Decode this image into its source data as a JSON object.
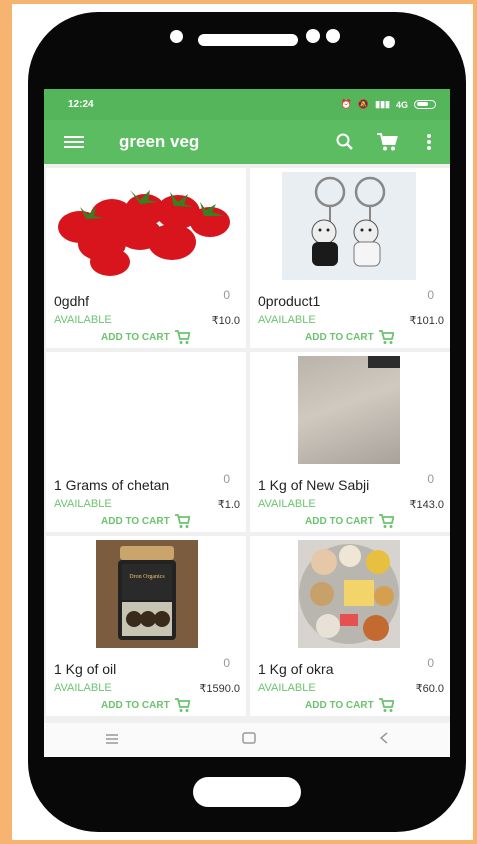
{
  "status": {
    "time": "12:24",
    "network": "4G"
  },
  "toolbar": {
    "title": "green veg",
    "icons": [
      "menu-icon",
      "search-icon",
      "cart-icon",
      "overflow-icon"
    ]
  },
  "products": [
    {
      "name": "0gdhf",
      "qty": "0",
      "availability": "AVAILABLE",
      "price": "₹10.0",
      "cart_label": "ADD TO CART",
      "image": "strawberries"
    },
    {
      "name": "0product1",
      "qty": "0",
      "availability": "AVAILABLE",
      "price": "₹101.0",
      "cart_label": "ADD TO CART",
      "image": "keychains"
    },
    {
      "name": "1 Grams of chetan",
      "qty": "0",
      "availability": "AVAILABLE",
      "price": "₹1.0",
      "cart_label": "ADD TO CART",
      "image": ""
    },
    {
      "name": "1 Kg of New Sabji",
      "qty": "0",
      "availability": "AVAILABLE",
      "price": "₹143.0",
      "cart_label": "ADD TO CART",
      "image": "photo"
    },
    {
      "name": "1 Kg of oil",
      "qty": "0",
      "availability": "AVAILABLE",
      "price": "₹1590.0",
      "cart_label": "ADD TO CART",
      "image": "jar"
    },
    {
      "name": "1 Kg of okra",
      "qty": "0",
      "availability": "AVAILABLE",
      "price": "₹60.0",
      "cart_label": "ADD TO CART",
      "image": "thali"
    }
  ],
  "jar_label": "Dron Organics",
  "colors": {
    "primary": "#5cbc62",
    "status": "#55b55a",
    "available": "#6cc46f",
    "frame": "#f6b470"
  }
}
